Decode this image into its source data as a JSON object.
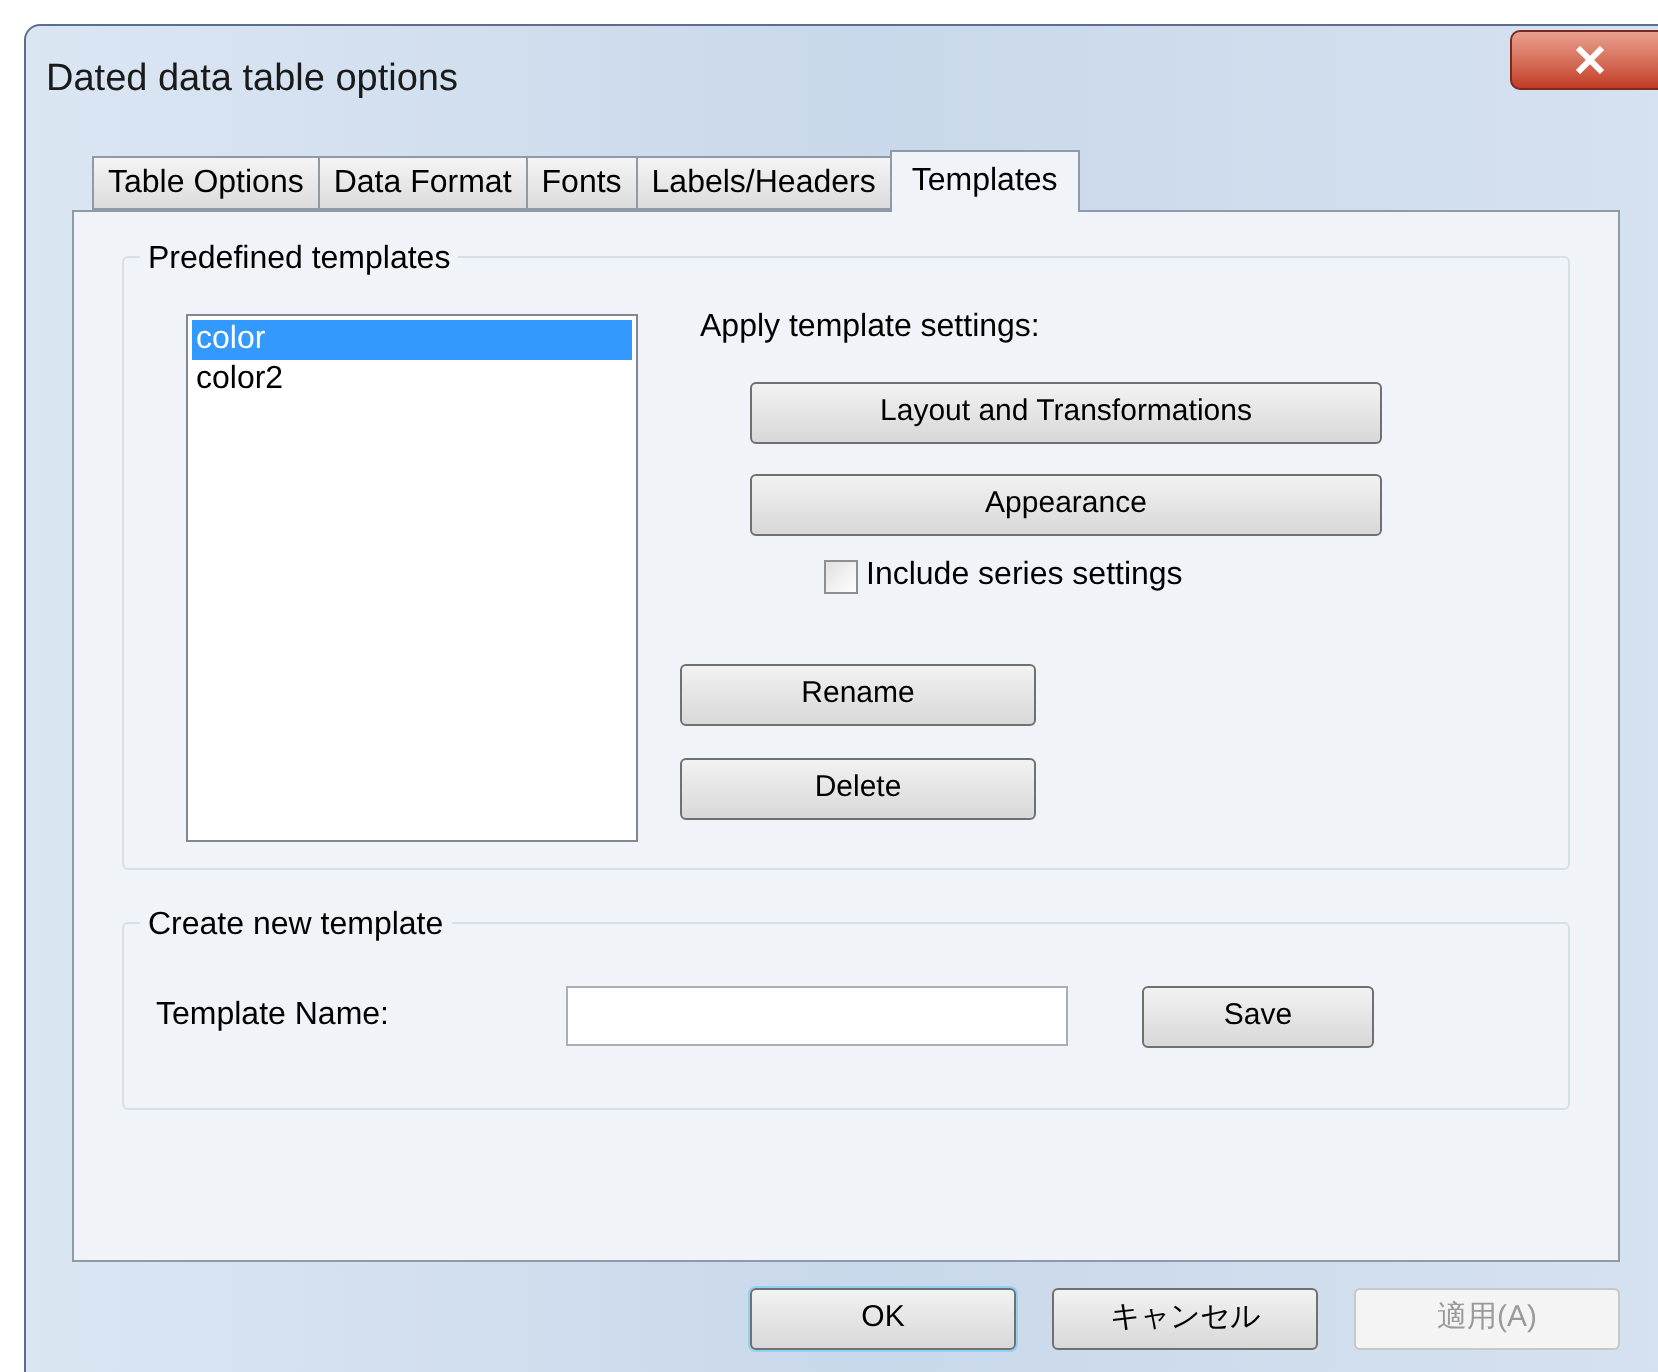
{
  "window": {
    "title": "Dated data table options"
  },
  "tabs": [
    {
      "label": "Table Options",
      "selected": false
    },
    {
      "label": "Data Format",
      "selected": false
    },
    {
      "label": "Fonts",
      "selected": false
    },
    {
      "label": "Labels/Headers",
      "selected": false
    },
    {
      "label": "Templates",
      "selected": true
    }
  ],
  "predefined": {
    "title": "Predefined templates",
    "items": [
      {
        "label": "color",
        "selected": true
      },
      {
        "label": "color2",
        "selected": false
      }
    ],
    "apply_label": "Apply template settings:",
    "apply_buttons": [
      "Layout and Transformations",
      "Appearance"
    ],
    "include_series": {
      "label": "Include series settings",
      "checked": false
    },
    "buttons": [
      "Rename",
      "Delete"
    ]
  },
  "create": {
    "title": "Create new template",
    "field_label": "Template Name:",
    "button": "Save"
  },
  "footer_buttons": [
    {
      "label": "OK",
      "default": true,
      "disabled": false
    },
    {
      "label": "キャンセル",
      "default": false,
      "disabled": false
    },
    {
      "label": "適用(A)",
      "default": false,
      "disabled": true
    }
  ]
}
